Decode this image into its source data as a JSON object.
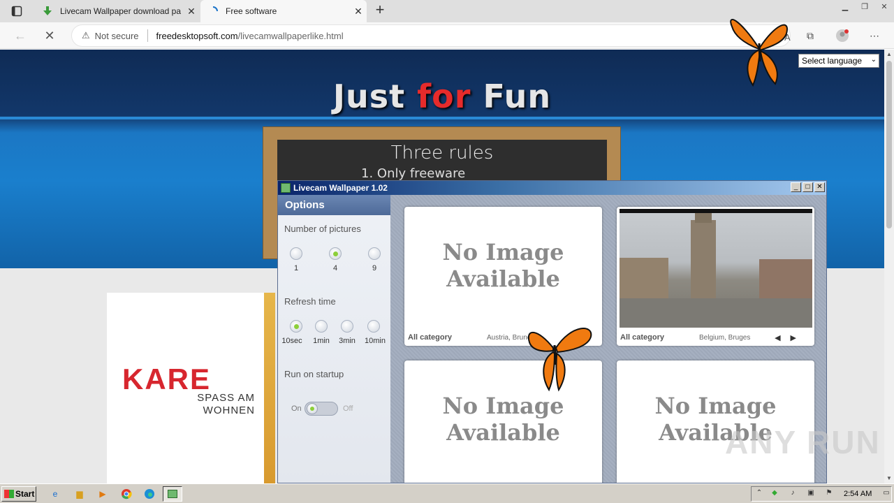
{
  "browser": {
    "tabs": [
      {
        "title": "Livecam Wallpaper download pa",
        "active": false
      },
      {
        "title": "Free software",
        "active": true
      }
    ],
    "security_label": "Not secure",
    "url_host": "freedesktopsoft.com",
    "url_path": "/livecamwallpaperlike.html"
  },
  "page": {
    "hero_part1": "Just ",
    "hero_part2": "for",
    "hero_part3": " Fun",
    "language_select": "Select language",
    "board_title": "Three rules",
    "board_rule": "1. Only freeware",
    "ad_brand": "KARE",
    "ad_tagline": "SPASS AM WOHNEN"
  },
  "app": {
    "title": "Livecam Wallpaper 1.02",
    "options_header": "Options",
    "number_label": "Number of pictures",
    "number_options": [
      "1",
      "4",
      "9"
    ],
    "number_selected": "4",
    "refresh_label": "Refresh time",
    "refresh_options": [
      "10sec",
      "1min",
      "3min",
      "10min"
    ],
    "refresh_selected": "10sec",
    "startup_label": "Run on startup",
    "startup_on": "On",
    "startup_off": "Off",
    "cams": [
      {
        "text1": "No Image",
        "text2": "Available",
        "category": "All category",
        "location": "Austria, Bruneck"
      },
      {
        "category": "All category",
        "location": "Belgium, Bruges"
      },
      {
        "text1": "No Image",
        "text2": "Available"
      },
      {
        "text1": "No Image",
        "text2": "Available"
      }
    ]
  },
  "taskbar": {
    "start_label": "Start",
    "clock": "2:54 AM"
  },
  "watermark": "ANY RUN",
  "colors": {
    "accent_red": "#e62b2b",
    "kare_red": "#d7262e",
    "radio_green": "#8ccf3a"
  }
}
